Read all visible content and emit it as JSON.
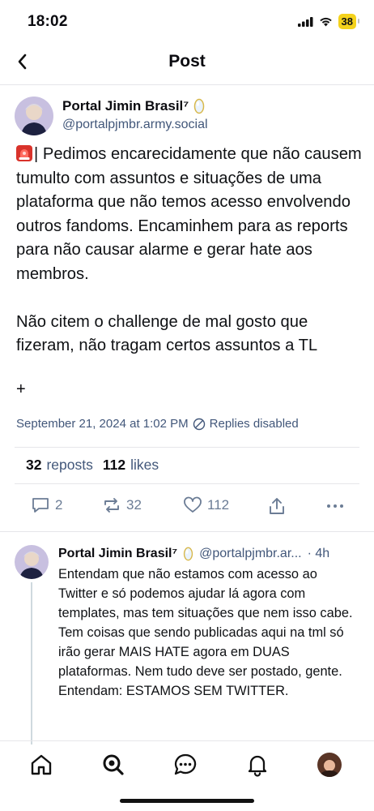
{
  "status_bar": {
    "time": "18:02",
    "battery": "38",
    "icons": [
      "cellular-signal-icon",
      "wifi-icon",
      "battery-icon"
    ]
  },
  "header": {
    "title": "Post",
    "back_icon": "chevron-left-icon"
  },
  "post": {
    "author_name": "Portal Jimin Brasil⁷",
    "author_handle": "@portalpjmbr.army.social",
    "badge_icon": "moonstone-emoji-icon",
    "emoji_icon": "siren-emoji-icon",
    "body": "| Pedimos encarecidamente que não causem tumulto com assuntos e situações de uma plataforma que não temos acesso envolvendo outros fandoms. Encaminhem para as reports para não causar alarme e gerar hate aos membros.\n\nNão citem o challenge de mal gosto que fizeram, não tragam certos assuntos a TL",
    "plus": "+",
    "timestamp": "September 21, 2024 at 1:02 PM",
    "replies_status": "Replies disabled",
    "reposts_count": "32",
    "reposts_label": "reposts",
    "likes_count": "112",
    "likes_label": "likes",
    "actions": {
      "reply_count": "2",
      "repost_count": "32",
      "like_count": "112"
    }
  },
  "reply": {
    "author_name": "Portal Jimin Brasil⁷",
    "author_handle": "@portalpjmbr.ar...",
    "time": "· 4h",
    "body": "Entendam que não estamos com acesso ao Twitter e só podemos ajudar lá agora com templates, mas tem situações que nem isso cabe. Tem coisas que sendo publicadas aqui na tml só irão gerar MAIS HATE agora em DUAS plataformas. Nem tudo deve ser postado, gente. Entendam: ESTAMOS SEM TWITTER."
  },
  "bottom_nav": [
    "home-icon",
    "search-icon",
    "chat-icon",
    "notifications-bell-icon",
    "profile-avatar"
  ],
  "colors": {
    "text": "#0b0b10",
    "secondary": "#42577a",
    "action_icons": "#6b7c95",
    "divider": "#e6e6ea",
    "battery": "#f4d21c"
  }
}
